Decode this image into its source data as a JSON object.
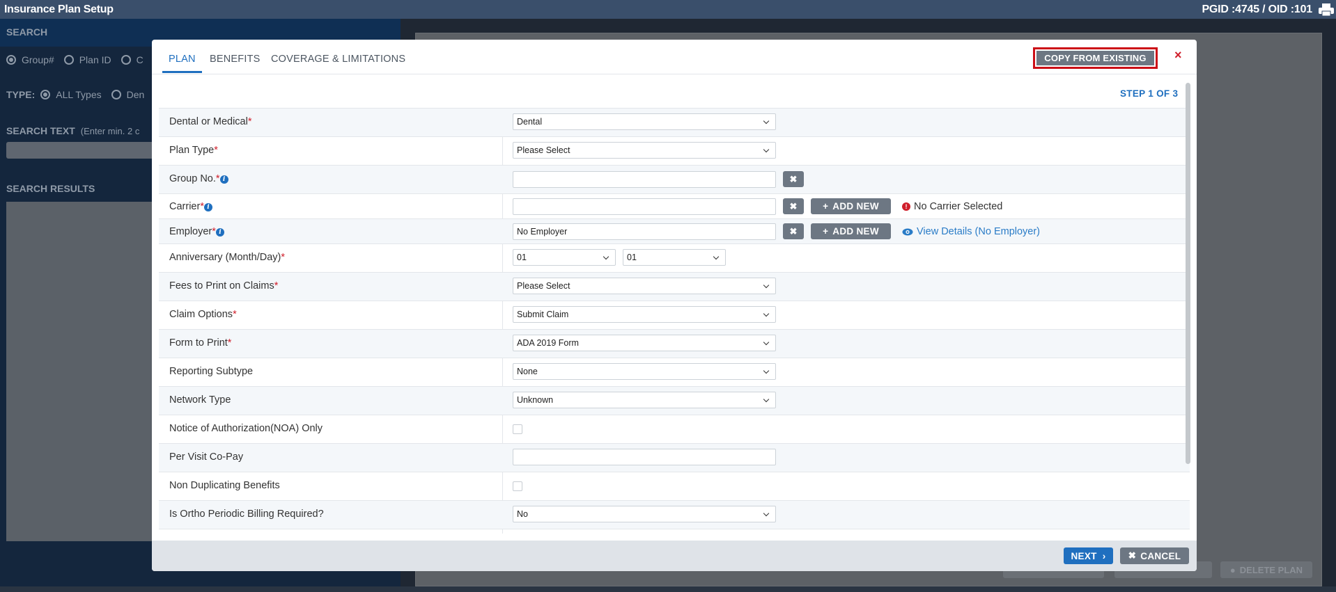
{
  "app": {
    "title": "Insurance Plan Setup",
    "ids": "PGID :4745  /  OID :101",
    "print_icon": "printer-icon"
  },
  "search_panel": {
    "heading": "SEARCH",
    "search_by": [
      "Group#",
      "Plan ID",
      "C"
    ],
    "type_label": "TYPE:",
    "type_options": [
      "ALL Types",
      "Den"
    ],
    "search_text_label": "SEARCH TEXT",
    "search_text_hint": "(Enter min. 2 c",
    "results_heading": "SEARCH RESULTS"
  },
  "background_buttons": {
    "delete_plan": "DELETE PLAN"
  },
  "modal": {
    "tabs": [
      "PLAN",
      "BENEFITS",
      "COVERAGE & LIMITATIONS"
    ],
    "active_tab": "PLAN",
    "copy_button": "COPY FROM EXISTING",
    "close_glyph": "×",
    "step": "STEP 1 OF 3",
    "rows": [
      {
        "label": "Dental or Medical",
        "required": "*",
        "value": "Dental"
      },
      {
        "label": "Plan Type",
        "required": "*",
        "value": "Please Select"
      },
      {
        "label": "Group No.",
        "required": "*",
        "value": ""
      },
      {
        "label": "Carrier",
        "required": "*",
        "value": "",
        "add": "ADD NEW",
        "warning": "No Carrier Selected"
      },
      {
        "label": "Employer",
        "required": "*",
        "value": "No Employer",
        "add": "ADD NEW",
        "link": "View Details (No Employer)"
      },
      {
        "label": "Anniversary (Month/Day)",
        "required": "*",
        "month": "01",
        "day": "01"
      },
      {
        "label": "Fees to Print on Claims",
        "required": "*",
        "value": "Please Select"
      },
      {
        "label": "Claim Options",
        "required": "*",
        "value": "Submit Claim"
      },
      {
        "label": "Form to Print",
        "required": "*",
        "value": "ADA 2019 Form"
      },
      {
        "label": "Reporting Subtype",
        "value": "None"
      },
      {
        "label": "Network Type",
        "value": "Unknown"
      },
      {
        "label": "Notice of Authorization(NOA) Only"
      },
      {
        "label": "Per Visit Co-Pay",
        "value": ""
      },
      {
        "label": "Non Duplicating Benefits"
      },
      {
        "label": "Is Ortho Periodic Billing Required?",
        "value": "No"
      }
    ],
    "next_button": "NEXT",
    "cancel_button": "CANCEL"
  },
  "colors": {
    "accent": "#1f6fbf",
    "required": "#d01f2b",
    "grey_button": "#6d7783",
    "copy_outline": "#cc0f17"
  }
}
